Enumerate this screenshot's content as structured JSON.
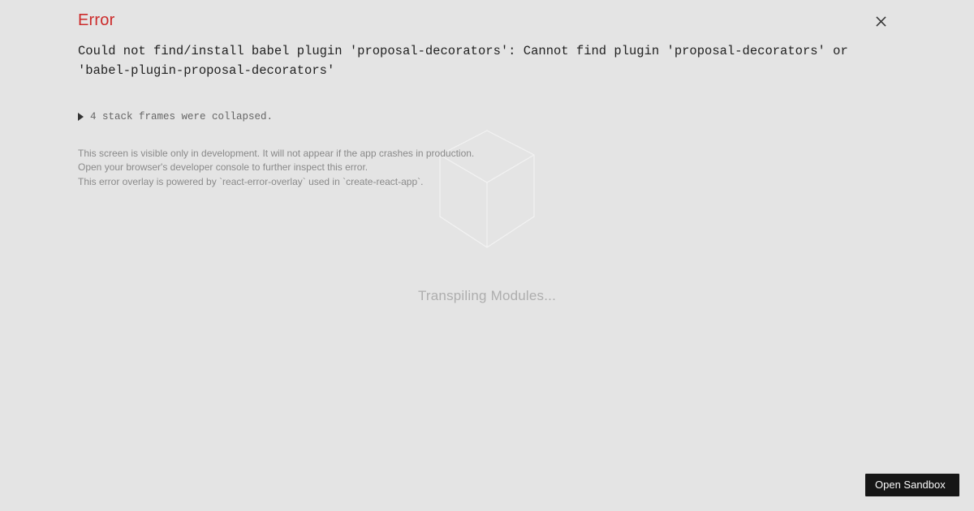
{
  "background": {
    "status_text": "Transpiling Modules..."
  },
  "error": {
    "title": "Error",
    "message": "Could not find/install babel plugin 'proposal-decorators': Cannot find plugin 'proposal-decorators' or 'babel-plugin-proposal-decorators'",
    "collapsed_label": "4 stack frames were collapsed.",
    "footer_line1": "This screen is visible only in development. It will not appear if the app crashes in production.",
    "footer_line2": "Open your browser's developer console to further inspect this error.",
    "footer_line3": "This error overlay is powered by `react-error-overlay` used in `create-react-app`."
  },
  "buttons": {
    "open_sandbox": "Open Sandbox"
  }
}
